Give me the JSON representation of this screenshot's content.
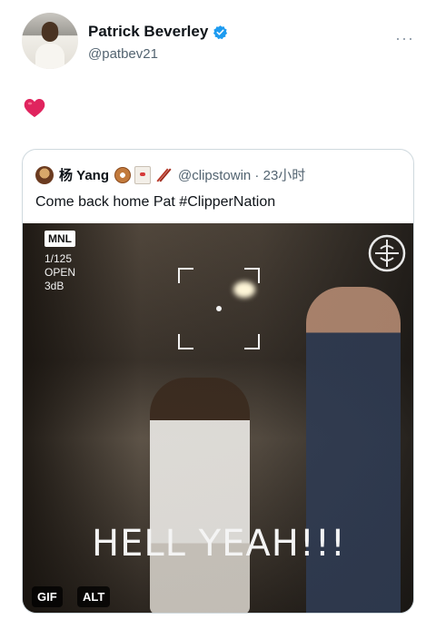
{
  "tweet": {
    "display_name": "Patrick Beverley",
    "handle": "@patbev21",
    "verified_icon": "verified-badge-icon",
    "more_icon": "more-horizontal-icon",
    "more_label": "···",
    "body_icon": "red-heart-emoji"
  },
  "quoted": {
    "name": "杨 Yang",
    "emojis": [
      "donut-emoji",
      "takeout-box-emoji",
      "chopsticks-emoji"
    ],
    "handle_time": "@clipstowin · 23小时",
    "text": "Come back home Pat #ClipperNation",
    "media": {
      "mode_badge": "MNL",
      "shutter": "1/125",
      "aperture": "OPEN",
      "gain": "3dB",
      "caption": "HELL YEAH!!!",
      "gif_badge": "GIF",
      "alt_badge": "ALT"
    }
  },
  "colors": {
    "text_primary": "#0f1419",
    "text_secondary": "#536471",
    "verified_blue": "#1d9bf0",
    "heart_red": "#e0245e",
    "border": "#cfd9de"
  }
}
